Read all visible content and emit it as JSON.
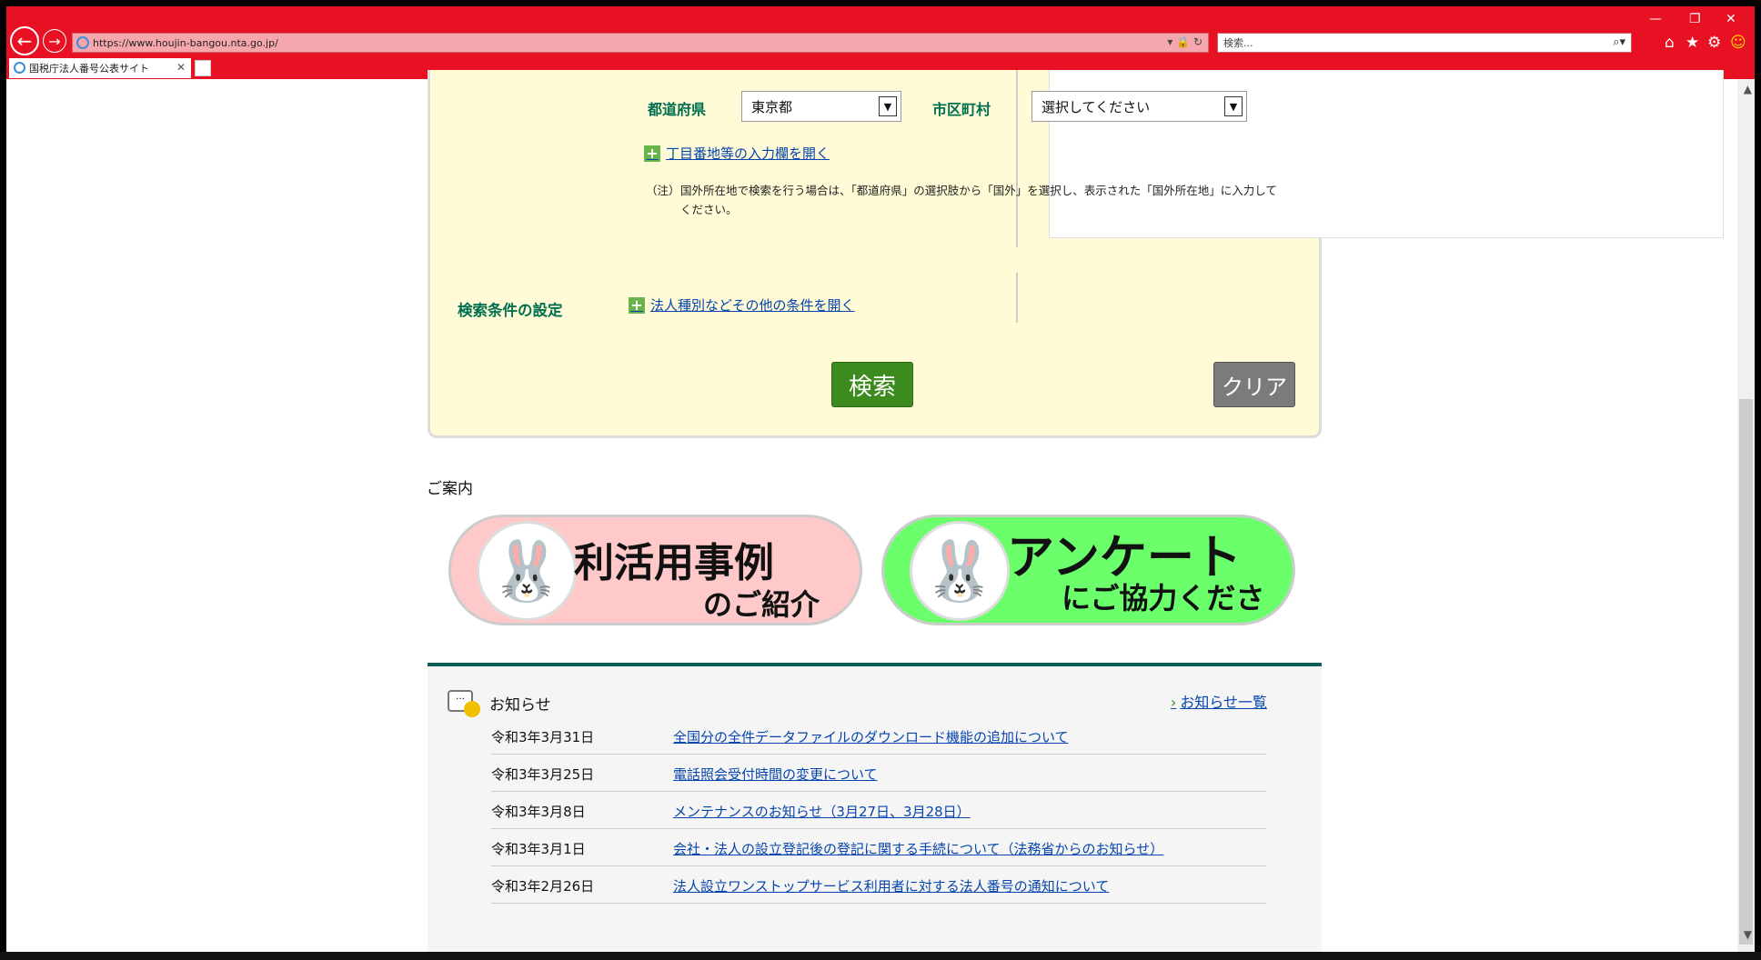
{
  "browser": {
    "url": "https://www.houjin-bangou.nta.go.jp/",
    "search_placeholder": "検索...",
    "tab_title": "国税庁法人番号公表サイト",
    "accent": "#e81123"
  },
  "form": {
    "pref_label": "都道府県",
    "pref_value": "東京都",
    "city_label": "市区町村",
    "city_value": "選択してください",
    "open_address_link": "丁目番地等の入力欄を開く",
    "note_head": "（注）",
    "note_body": "国外所在地で検索を行う場合は、「都道府県」の選択肢から「国外」を選択し、表示された「国外所在地」に入力してください。",
    "conditions_label": "検索条件の設定",
    "conditions_link": "法人種別などその他の条件を開く",
    "search_button": "検索",
    "clear_button": "クリア"
  },
  "guide": {
    "heading": "ご案内",
    "banner1_line1": "利活用事例",
    "banner1_line2": "のご紹介",
    "banner2_line1": "アンケート",
    "banner2_line2": "にご協力ください"
  },
  "news": {
    "title": "お知らせ",
    "all_link": "お知らせ一覧",
    "items": [
      {
        "date": "令和3年3月31日",
        "title": "全国分の全件データファイルのダウンロード機能の追加について"
      },
      {
        "date": "令和3年3月25日",
        "title": "電話照会受付時間の変更について"
      },
      {
        "date": "令和3年3月8日",
        "title": "メンテナンスのお知らせ（3月27日、3月28日）"
      },
      {
        "date": "令和3年3月1日",
        "title": "会社・法人の設立登記後の登記に関する手続について（法務省からのお知らせ）"
      },
      {
        "date": "令和3年2月26日",
        "title": "法人設立ワンストップサービス利用者に対する法人番号の通知について"
      }
    ]
  }
}
